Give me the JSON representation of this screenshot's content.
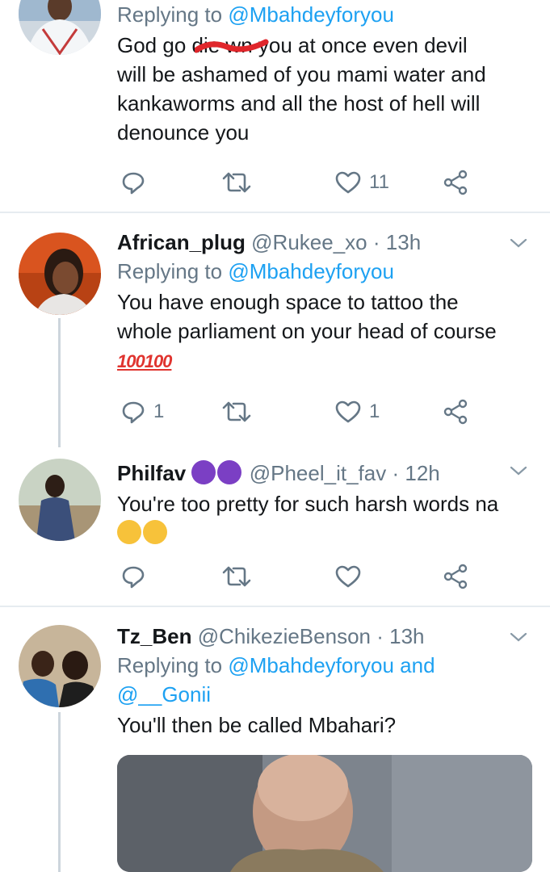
{
  "tweets": [
    {
      "reply_to_prefix": "Replying to",
      "reply_to_handle": "@Mbahdeyforyou",
      "text_lines": [
        "God go die wn you at once even devil",
        "will be ashamed of you mami water and",
        "kankaworms and all the host of hell will",
        "denounce you"
      ],
      "reply_count": "",
      "like_count": "11"
    },
    {
      "name": "African_plug",
      "handle": "@Rukee_xo",
      "time": "13h",
      "reply_to_prefix": "Replying to",
      "reply_to_handle": "@Mbahdeyforyou",
      "text_lines": [
        "You have enough space to tattoo the",
        "whole parliament on your head of course"
      ],
      "emoji_text": "100100",
      "reply_count": "1",
      "like_count": "1"
    },
    {
      "name": "Philfav",
      "handle": "@Pheel_it_fav",
      "time": "12h",
      "text_lines": [
        "You're too pretty for such harsh words na"
      ],
      "emojis": [
        "smiling-devil-emoji",
        "smiling-devil-emoji",
        "grinning-sweat-emoji",
        "grinning-sweat-emoji"
      ],
      "reply_count": "",
      "like_count": ""
    },
    {
      "name": "Tz_Ben",
      "handle": "@ChikezieBenson",
      "time": "13h",
      "reply_to_prefix": "Replying to",
      "reply_to_handle": "@Mbahdeyforyou and",
      "reply_to_handle_2": "@__Gonii",
      "text_lines": [
        "You'll then be called Mbahari?"
      ]
    }
  ],
  "separator": "·",
  "colors": {
    "accent": "#1da1f2",
    "secondary_text": "#657786",
    "divider": "#e6ecf0"
  },
  "icons": [
    "reply-icon",
    "retweet-icon",
    "like-icon",
    "share-icon",
    "chevron-down-icon"
  ]
}
